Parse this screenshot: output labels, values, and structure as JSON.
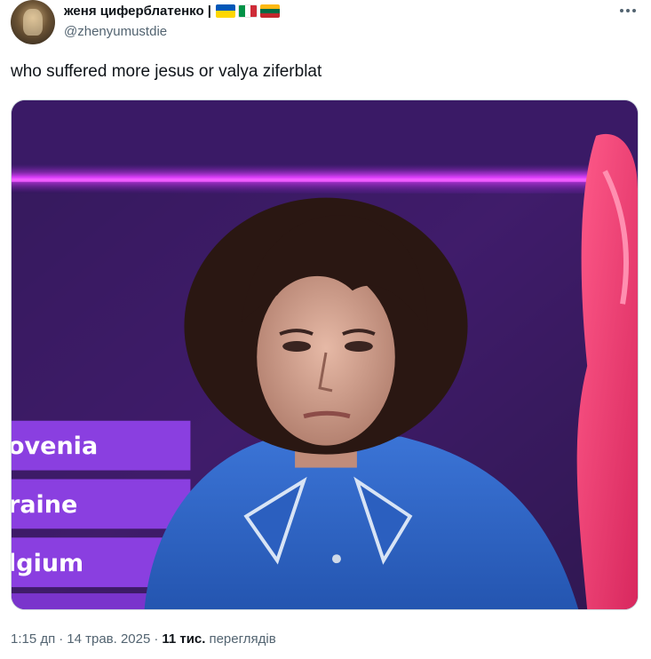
{
  "author": {
    "display_name": "женя циферблатенко |",
    "handle": "@zhenyumustdie",
    "flags": [
      "ukraine-flag",
      "italy-flag",
      "lithuania-flag"
    ]
  },
  "tweet": {
    "text": "who suffered more jesus or valya ziferblat"
  },
  "media": {
    "scoreboard_labels": [
      "ovenia",
      "raine",
      "lgium"
    ],
    "colors": {
      "board_purple": "#8a3fe0",
      "stage_magenta": "#c01ee0",
      "shirt_blue": "#2f66c8"
    }
  },
  "meta": {
    "time": "1:15 дп",
    "separator": "·",
    "date": "14 трав. 2025",
    "views_count": "11 тис.",
    "views_label": "переглядів"
  }
}
